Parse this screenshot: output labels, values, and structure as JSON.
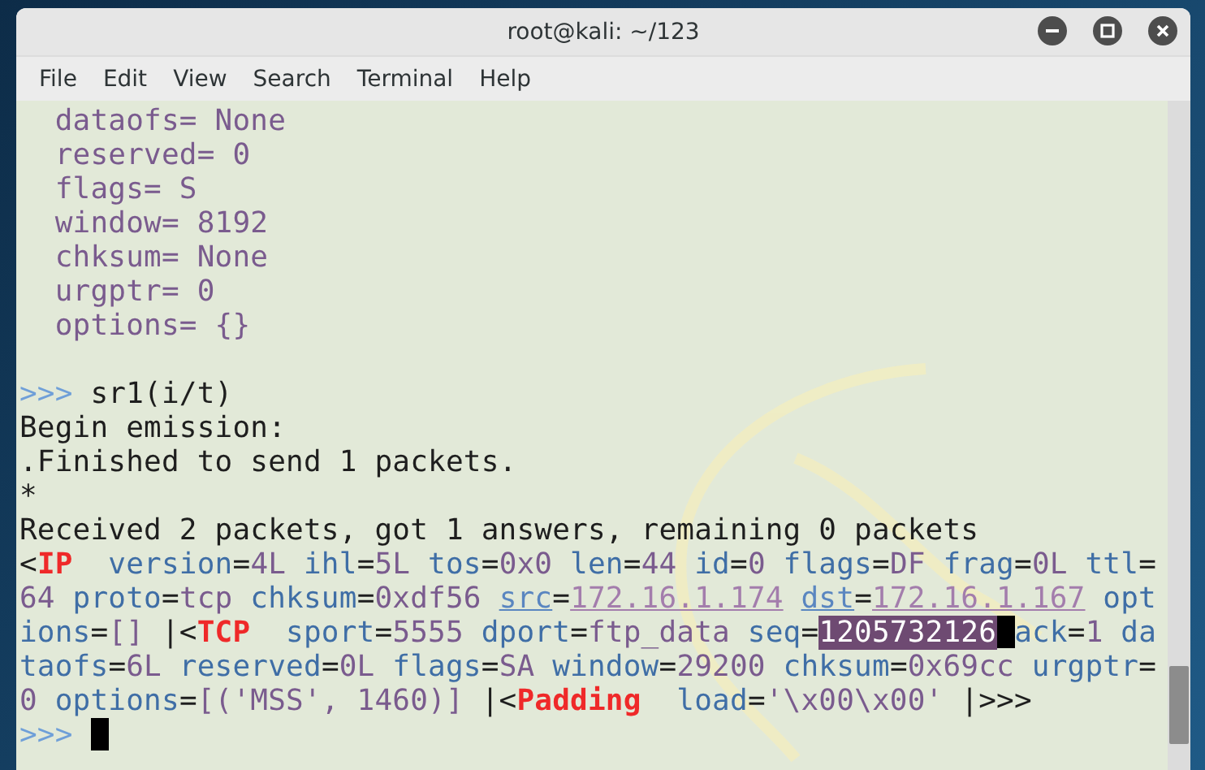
{
  "window": {
    "title": "root@kali: ~/123"
  },
  "menu": [
    "File",
    "Edit",
    "View",
    "Search",
    "Terminal",
    "Help"
  ],
  "terminal": {
    "lines": [
      {
        "kind": "output",
        "segments": [
          {
            "kind": "value",
            "text": "  dataofs= None"
          }
        ]
      },
      {
        "kind": "output",
        "segments": [
          {
            "kind": "value",
            "text": "  reserved= 0"
          }
        ]
      },
      {
        "kind": "output",
        "segments": [
          {
            "kind": "value",
            "text": "  flags= S"
          }
        ]
      },
      {
        "kind": "output",
        "segments": [
          {
            "kind": "value",
            "text": "  window= 8192"
          }
        ]
      },
      {
        "kind": "output",
        "segments": [
          {
            "kind": "value",
            "text": "  chksum= None"
          }
        ]
      },
      {
        "kind": "output",
        "segments": [
          {
            "kind": "value",
            "text": "  urgptr= 0"
          }
        ]
      },
      {
        "kind": "output",
        "segments": [
          {
            "kind": "value",
            "text": "  options= {}"
          }
        ]
      },
      {
        "kind": "blank"
      },
      {
        "kind": "output",
        "segments": [
          {
            "kind": "prompt",
            "text": ">>> "
          },
          {
            "kind": "text",
            "text": "sr1(i/t)"
          }
        ]
      },
      {
        "kind": "output",
        "segments": [
          {
            "kind": "text",
            "text": "Begin emission:"
          }
        ]
      },
      {
        "kind": "output",
        "segments": [
          {
            "kind": "text",
            "text": ".Finished to send 1 packets."
          }
        ]
      },
      {
        "kind": "output",
        "segments": [
          {
            "kind": "text",
            "text": "*"
          }
        ]
      },
      {
        "kind": "output",
        "segments": [
          {
            "kind": "text",
            "text": "Received 2 packets, got 1 answers, remaining 0 packets"
          }
        ]
      },
      {
        "kind": "output",
        "segments": [
          {
            "kind": "text",
            "text": "<"
          },
          {
            "kind": "layer",
            "text": "IP"
          },
          {
            "kind": "key",
            "text": "  version"
          },
          {
            "kind": "text",
            "text": "="
          },
          {
            "kind": "value",
            "text": "4L"
          },
          {
            "kind": "key",
            "text": " ihl"
          },
          {
            "kind": "text",
            "text": "="
          },
          {
            "kind": "value",
            "text": "5L"
          },
          {
            "kind": "key",
            "text": " tos"
          },
          {
            "kind": "text",
            "text": "="
          },
          {
            "kind": "value",
            "text": "0x0"
          },
          {
            "kind": "key",
            "text": " len"
          },
          {
            "kind": "text",
            "text": "="
          },
          {
            "kind": "value",
            "text": "44"
          },
          {
            "kind": "key",
            "text": " id"
          },
          {
            "kind": "text",
            "text": "="
          },
          {
            "kind": "value",
            "text": "0"
          },
          {
            "kind": "key",
            "text": " flags"
          },
          {
            "kind": "text",
            "text": "="
          },
          {
            "kind": "value",
            "text": "DF"
          },
          {
            "kind": "key",
            "text": " frag"
          },
          {
            "kind": "text",
            "text": "="
          },
          {
            "kind": "value",
            "text": "0L"
          },
          {
            "kind": "key",
            "text": " ttl"
          },
          {
            "kind": "text",
            "text": "="
          }
        ]
      },
      {
        "kind": "output",
        "segments": [
          {
            "kind": "value",
            "text": "64"
          },
          {
            "kind": "key",
            "text": " proto"
          },
          {
            "kind": "text",
            "text": "="
          },
          {
            "kind": "value",
            "text": "tcp"
          },
          {
            "kind": "key",
            "text": " chksum"
          },
          {
            "kind": "text",
            "text": "="
          },
          {
            "kind": "value",
            "text": "0xdf56 "
          },
          {
            "kind": "link-key",
            "text": "src"
          },
          {
            "kind": "text",
            "text": "="
          },
          {
            "kind": "link-value",
            "text": "172.16.1.174 "
          },
          {
            "kind": "link-key",
            "text": "dst"
          },
          {
            "kind": "text",
            "text": "="
          },
          {
            "kind": "link-value",
            "text": "172.16.1.167"
          },
          {
            "kind": "key",
            "text": " opt"
          }
        ]
      },
      {
        "kind": "output",
        "segments": [
          {
            "kind": "key",
            "text": "ions"
          },
          {
            "kind": "text",
            "text": "="
          },
          {
            "kind": "value",
            "text": "[]"
          },
          {
            "kind": "text",
            "text": " |<"
          },
          {
            "kind": "layer",
            "text": "TCP"
          },
          {
            "kind": "key",
            "text": "  sport"
          },
          {
            "kind": "text",
            "text": "="
          },
          {
            "kind": "value",
            "text": "5555"
          },
          {
            "kind": "key",
            "text": " dport"
          },
          {
            "kind": "text",
            "text": "="
          },
          {
            "kind": "value",
            "text": "ftp_data"
          },
          {
            "kind": "key",
            "text": " seq"
          },
          {
            "kind": "text",
            "text": "="
          },
          {
            "kind": "selected",
            "text": "1205732126"
          },
          {
            "kind": "cursor"
          },
          {
            "kind": "key",
            "text": "ack"
          },
          {
            "kind": "text",
            "text": "="
          },
          {
            "kind": "value",
            "text": "1"
          },
          {
            "kind": "key",
            "text": " da"
          }
        ]
      },
      {
        "kind": "output",
        "segments": [
          {
            "kind": "key",
            "text": "taofs"
          },
          {
            "kind": "text",
            "text": "="
          },
          {
            "kind": "value",
            "text": "6L"
          },
          {
            "kind": "key",
            "text": " reserved"
          },
          {
            "kind": "text",
            "text": "="
          },
          {
            "kind": "value",
            "text": "0L"
          },
          {
            "kind": "key",
            "text": " flags"
          },
          {
            "kind": "text",
            "text": "="
          },
          {
            "kind": "value",
            "text": "SA"
          },
          {
            "kind": "key",
            "text": " window"
          },
          {
            "kind": "text",
            "text": "="
          },
          {
            "kind": "value",
            "text": "29200"
          },
          {
            "kind": "key",
            "text": " chksum"
          },
          {
            "kind": "text",
            "text": "="
          },
          {
            "kind": "value",
            "text": "0x69cc"
          },
          {
            "kind": "key",
            "text": " urgptr"
          },
          {
            "kind": "text",
            "text": "="
          }
        ]
      },
      {
        "kind": "output",
        "segments": [
          {
            "kind": "value",
            "text": "0"
          },
          {
            "kind": "key",
            "text": " options"
          },
          {
            "kind": "text",
            "text": "="
          },
          {
            "kind": "value",
            "text": "[('MSS', 1460)]"
          },
          {
            "kind": "text",
            "text": " |<"
          },
          {
            "kind": "layer",
            "text": "Padding"
          },
          {
            "kind": "key",
            "text": "  load"
          },
          {
            "kind": "text",
            "text": "="
          },
          {
            "kind": "value",
            "text": "'\\x00\\x00'"
          },
          {
            "kind": "text",
            "text": " |>>>"
          }
        ]
      },
      {
        "kind": "output",
        "segments": [
          {
            "kind": "prompt",
            "text": ">>> "
          },
          {
            "kind": "cursor"
          }
        ]
      }
    ]
  }
}
